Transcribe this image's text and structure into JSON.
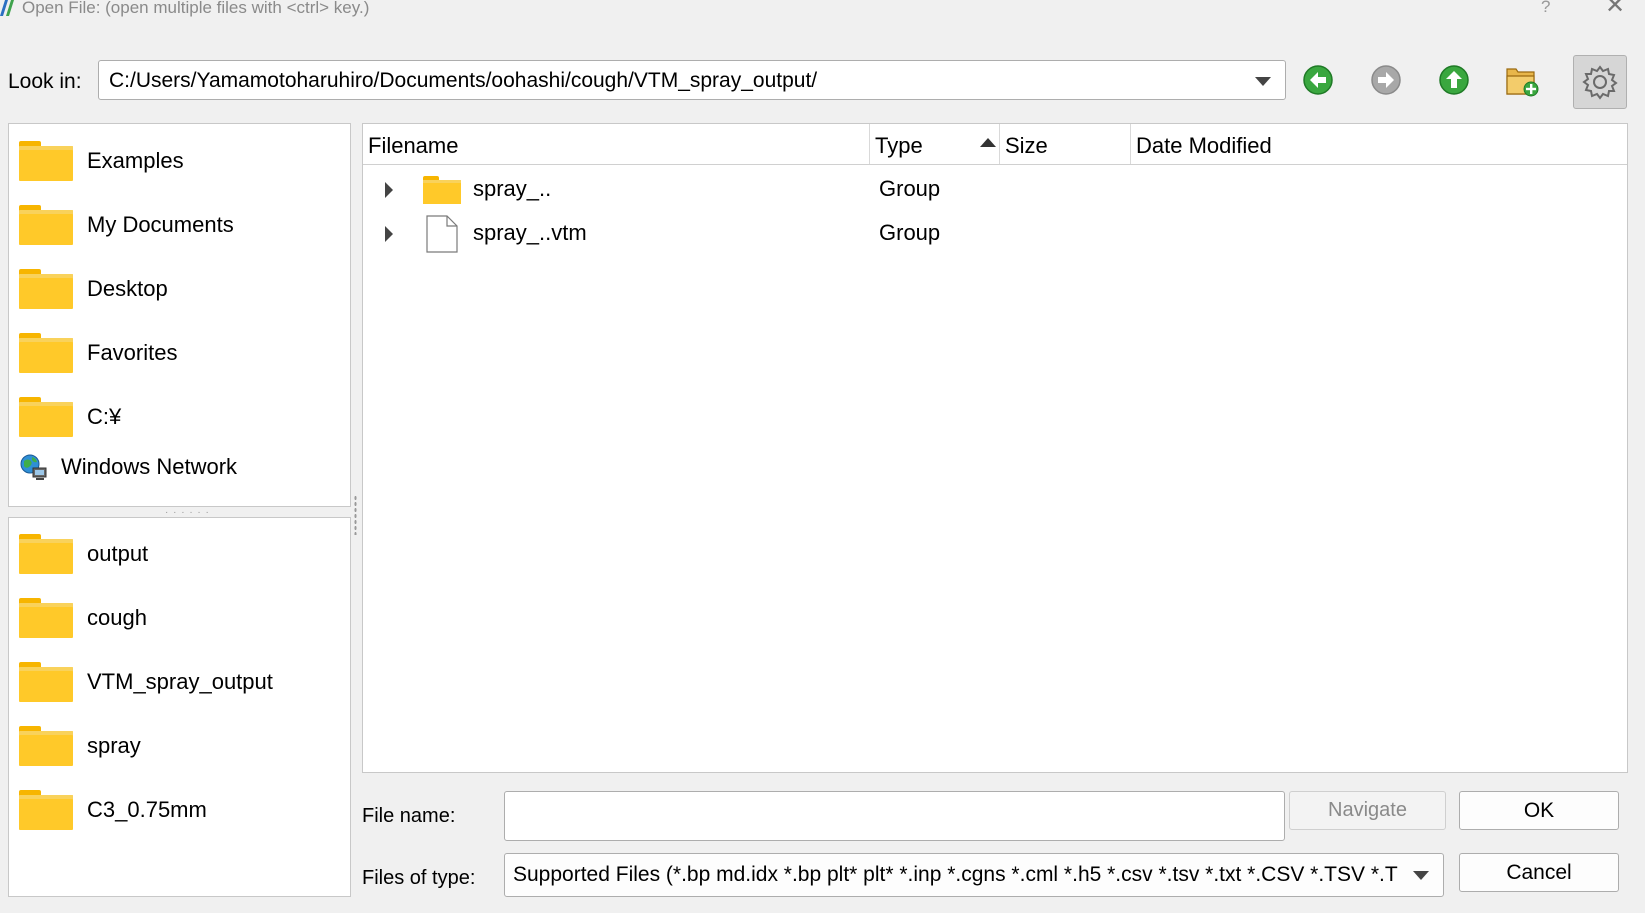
{
  "window": {
    "title": "Open File:  (open multiple files with <ctrl> key.)",
    "help_glyph": "?",
    "close_glyph": "✕"
  },
  "lookin": {
    "label": "Look in:",
    "path": "C:/Users/Yamamotoharuhiro/Documents/oohashi/cough/VTM_spray_output/"
  },
  "toolbar": {
    "back_icon": "back-arrow-icon",
    "forward_icon": "forward-arrow-icon",
    "up_icon": "up-arrow-icon",
    "new_folder_icon": "new-folder-icon",
    "settings_icon": "gear-icon",
    "accent_green": "#2e9d36",
    "disabled_gray": "#9a9a9a"
  },
  "places": [
    {
      "label": "Examples",
      "icon": "folder-icon"
    },
    {
      "label": "My Documents",
      "icon": "folder-icon"
    },
    {
      "label": "Desktop",
      "icon": "folder-icon"
    },
    {
      "label": "Favorites",
      "icon": "folder-icon"
    },
    {
      "label": "C:¥",
      "icon": "folder-icon"
    },
    {
      "label": "Windows Network",
      "icon": "network-icon"
    }
  ],
  "recent": [
    {
      "label": "output",
      "icon": "folder-icon"
    },
    {
      "label": "cough",
      "icon": "folder-icon"
    },
    {
      "label": "VTM_spray_output",
      "icon": "folder-icon"
    },
    {
      "label": "spray",
      "icon": "folder-icon"
    },
    {
      "label": "C3_0.75mm",
      "icon": "folder-icon"
    }
  ],
  "file_list": {
    "columns": [
      "Filename",
      "Type",
      "Size",
      "Date Modified"
    ],
    "sort_column": "Type",
    "sort_order": "ascending",
    "rows": [
      {
        "name": "spray_..",
        "type": "Group",
        "icon": "folder-icon"
      },
      {
        "name": "spray_..vtm",
        "type": "Group",
        "icon": "document-icon"
      }
    ]
  },
  "bottom": {
    "filename_label": "File name:",
    "filename_value": "",
    "navigate_label": "Navigate",
    "ok_label": "OK",
    "filetype_label": "Files of type:",
    "filetype_value": "Supported Files (*.bp md.idx *.bp plt* plt* *.inp *.cgns *.cml *.h5 *.csv *.tsv *.txt *.CSV *.TSV *.TXT",
    "cancel_label": "Cancel"
  }
}
